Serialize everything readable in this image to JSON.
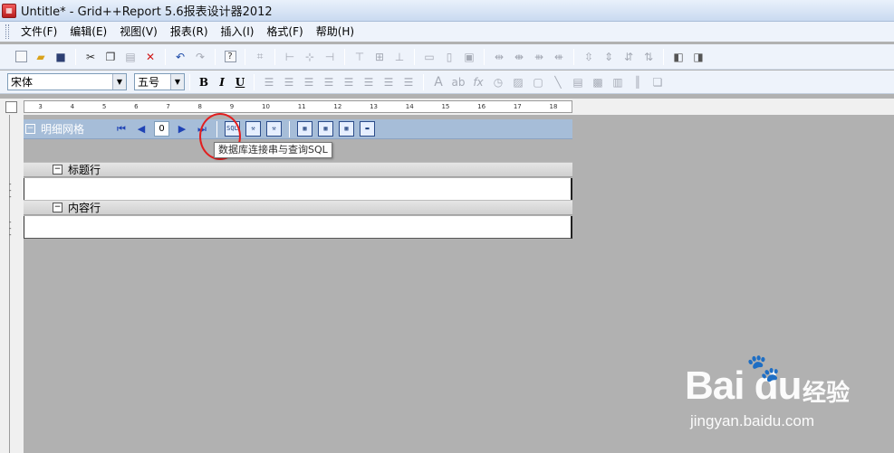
{
  "window": {
    "title": "Untitle* - Grid++Report 5.6报表设计器2012",
    "app_icon": "report-app-icon"
  },
  "menu": [
    {
      "label": "文件(F)"
    },
    {
      "label": "编辑(E)"
    },
    {
      "label": "视图(V)"
    },
    {
      "label": "报表(R)"
    },
    {
      "label": "插入(I)"
    },
    {
      "label": "格式(F)"
    },
    {
      "label": "帮助(H)"
    }
  ],
  "format_toolbar": {
    "font_name": "宋体",
    "font_size": "五号",
    "bold_label": "B",
    "italic_label": "I",
    "underline_label": "U",
    "text_tool": "A",
    "text_tool_small": "ab",
    "fx_tool": "fx"
  },
  "ruler": {
    "labels": [
      "3",
      "4",
      "5",
      "6",
      "7",
      "8",
      "9",
      "10",
      "11",
      "12",
      "13",
      "14",
      "15",
      "16",
      "17",
      "18"
    ]
  },
  "detail_grid": {
    "title": "明细网格",
    "page_number": "0",
    "tooltip": "数据库连接串与查询SQL",
    "sql_icon_text": "SQL"
  },
  "bands": [
    {
      "label": "标题行"
    },
    {
      "label": "内容行"
    }
  ],
  "watermark": {
    "logo": "Bai du",
    "cn": "经验",
    "url": "jingyan.baidu.com"
  },
  "colors": {
    "grid_toolbar": "#a6bdd8",
    "canvas": "#b1b1b1",
    "highlight": "#e21f1f"
  }
}
